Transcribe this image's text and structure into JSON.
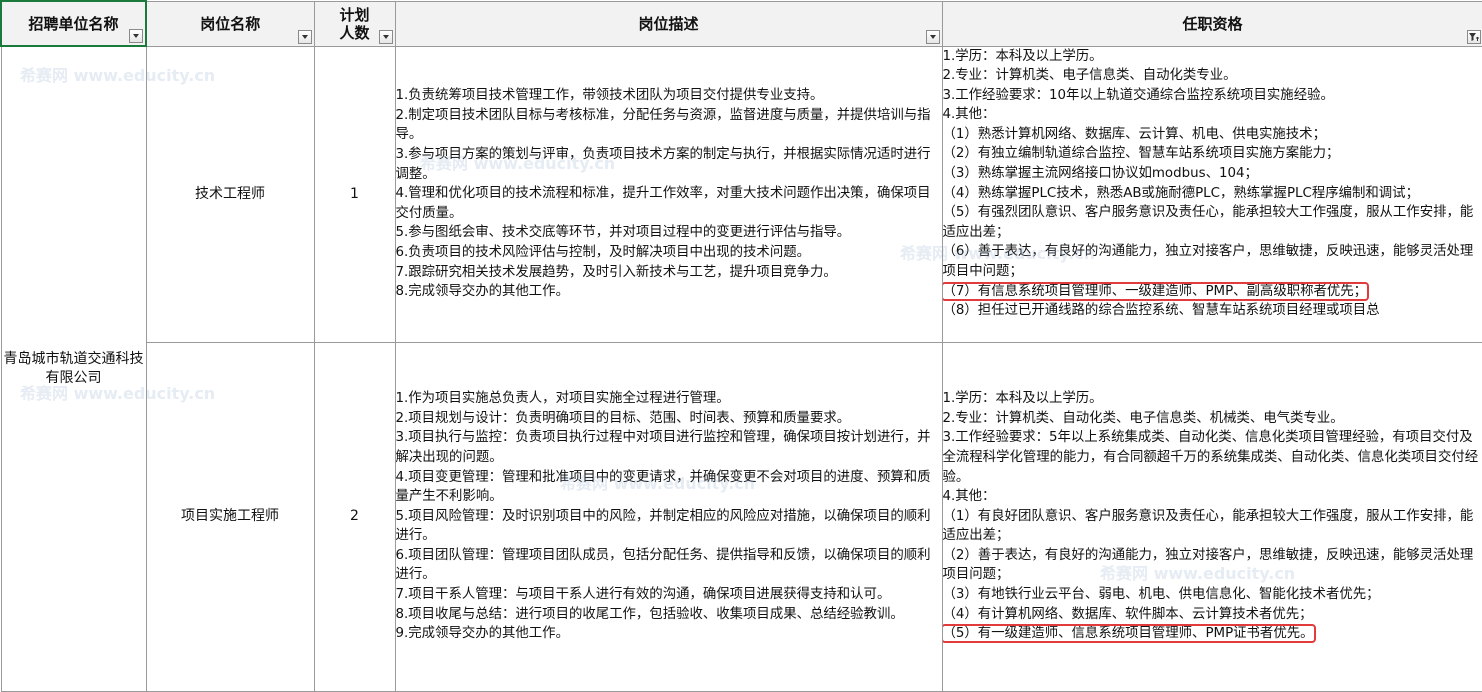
{
  "headers": {
    "company": "招聘单位名称",
    "position": "岗位名称",
    "count_line1": "计划",
    "count_line2": "人数",
    "description": "岗位描述",
    "qualification": "任职资格"
  },
  "company_name": "青岛城市轨道交通科技有限公司",
  "rows": [
    {
      "position": "技术工程师",
      "count": "1",
      "description": [
        "1.负责统筹项目技术管理工作，带领技术团队为项目交付提供专业支持。",
        "2.制定项目技术团队目标与考核标准，分配任务与资源，监督进度与质量，并提供培训与指导。",
        "3.参与项目方案的策划与评审，负责项目技术方案的制定与执行，并根据实际情况适时进行调整。",
        "4.管理和优化项目的技术流程和标准，提升工作效率，对重大技术问题作出决策，确保项目交付质量。",
        "5.参与图纸会审、技术交底等环节，并对项目过程中的变更进行评估与指导。",
        "6.负责项目的技术风险评估与控制，及时解决项目中出现的技术问题。",
        "7.跟踪研究相关技术发展趋势，及时引入新技术与工艺，提升项目竞争力。",
        "8.完成领导交办的其他工作。"
      ],
      "qualification": [
        "1.学历：本科及以上学历。",
        "2.专业：计算机类、电子信息类、自动化类专业。",
        "3.工作经验要求：10年以上轨道交通综合监控系统项目实施经验。",
        "4.其他：",
        "（1）熟悉计算机网络、数据库、云计算、机电、供电实施技术；",
        "（2）有独立编制轨道综合监控、智慧车站系统项目实施方案能力；",
        "（3）熟练掌握主流网络接口协议如modbus、104；",
        "（4）熟练掌握PLC技术，熟悉AB或施耐德PLC，熟练掌握PLC程序编制和调试；",
        "（5）有强烈团队意识、客户服务意识及责任心，能承担较大工作强度，服从工作安排，能适应出差；",
        "（6）善于表达，有良好的沟通能力，独立对接客户，思维敏捷，反映迅速，能够灵活处理项目中问题；",
        "（7）有信息系统项目管理师、一级建造师、PMP、副高级职称者优先；",
        "（8）担任过已开通线路的综合监控系统、智慧车站系统项目经理或项目总"
      ]
    },
    {
      "position": "项目实施工程师",
      "count": "2",
      "description": [
        "1.作为项目实施总负责人，对项目实施全过程进行管理。",
        "2.项目规划与设计：负责明确项目的目标、范围、时间表、预算和质量要求。",
        "3.项目执行与监控：负责项目执行过程中对项目进行监控和管理，确保项目按计划进行，并解决出现的问题。",
        "4.项目变更管理：管理和批准项目中的变更请求，并确保变更不会对项目的进度、预算和质量产生不利影响。",
        "5.项目风险管理：及时识别项目中的风险，并制定相应的风险应对措施，以确保项目的顺利进行。",
        "6.项目团队管理：管理项目团队成员，包括分配任务、提供指导和反馈，以确保项目的顺利进行。",
        "7.项目干系人管理：与项目干系人进行有效的沟通，确保项目进展获得支持和认可。",
        "8.项目收尾与总结：进行项目的收尾工作，包括验收、收集项目成果、总结经验教训。",
        "9.完成领导交办的其他工作。"
      ],
      "qualification": [
        "1.学历：本科及以上学历。",
        "2.专业：计算机类、自动化类、电子信息类、机械类、电气类专业。",
        "3.工作经验要求：5年以上系统集成类、自动化类、信息化类项目管理经验，有项目交付及全流程科学化管理的能力，有合同额超千万的系统集成类、自动化类、信息化类项目交付经验。",
        "4.其他：",
        "（1）有良好团队意识、客户服务意识及责任心，能承担较大工作强度，服从工作安排，能适应出差；",
        "（2）善于表达，有良好的沟通能力，独立对接客户，思维敏捷，反映迅速，能够灵活处理项目问题；",
        "（3）有地铁行业云平台、弱电、机电、供电信息化、智能化技术者优先；",
        "（4）有计算机网络、数据库、软件脚本、云计算技术者优先；",
        "（5）有一级建造师、信息系统项目管理师、PMP证书者优先。"
      ]
    }
  ],
  "watermark": "希赛网 www.educity.cn",
  "colors": {
    "highlight": "#e23b3b",
    "header_bg": "#f2f2f2",
    "selection": "#1a7a3c"
  }
}
